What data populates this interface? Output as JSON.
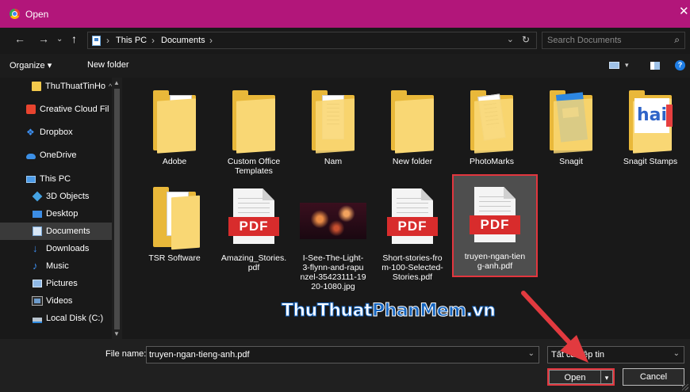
{
  "window": {
    "title": "Open"
  },
  "address": {
    "crumbs": [
      "This PC",
      "Documents"
    ],
    "search_placeholder": "Search Documents"
  },
  "toolbar": {
    "organize": "Organize ▾",
    "new_folder": "New folder"
  },
  "sidebar": {
    "items": [
      {
        "label": "ThuThuatTinHo",
        "icon": "folder-icon"
      },
      {
        "label": "Creative Cloud Fil",
        "icon": "creative-cloud-icon"
      },
      {
        "label": "Dropbox",
        "icon": "dropbox-icon"
      },
      {
        "label": "OneDrive",
        "icon": "onedrive-icon"
      },
      {
        "label": "This PC",
        "icon": "this-pc-icon"
      },
      {
        "label": "3D Objects",
        "icon": "3d-objects-icon"
      },
      {
        "label": "Desktop",
        "icon": "desktop-icon"
      },
      {
        "label": "Documents",
        "icon": "documents-icon",
        "selected": true
      },
      {
        "label": "Downloads",
        "icon": "downloads-icon"
      },
      {
        "label": "Music",
        "icon": "music-icon"
      },
      {
        "label": "Pictures",
        "icon": "pictures-icon"
      },
      {
        "label": "Videos",
        "icon": "videos-icon"
      },
      {
        "label": "Local Disk (C:)",
        "icon": "local-disk-icon"
      }
    ]
  },
  "files": [
    {
      "name": "Adobe",
      "type": "folder"
    },
    {
      "name": "Custom Office\nTemplates",
      "type": "folder"
    },
    {
      "name": "Nam",
      "type": "folder"
    },
    {
      "name": "New folder",
      "type": "folder"
    },
    {
      "name": "PhotoMarks",
      "type": "folder"
    },
    {
      "name": "Snagit",
      "type": "folder"
    },
    {
      "name": "Snagit Stamps",
      "type": "folder"
    },
    {
      "name": "TSR Software",
      "type": "folder"
    },
    {
      "name": "Amazing_Stories.\npdf",
      "type": "pdf",
      "badge": "PDF"
    },
    {
      "name": "I-See-The-Light-\n3-flynn-and-rapu\nnzel-35423111-19\n20-1080.jpg",
      "type": "image"
    },
    {
      "name": "Short-stories-fro\nm-100-Selected-\nStories.pdf",
      "type": "pdf",
      "badge": "PDF"
    },
    {
      "name": "truyen-ngan-tien\ng-anh.pdf",
      "type": "pdf",
      "badge": "PDF",
      "selected": true
    }
  ],
  "watermark": {
    "part1": "ThuThuat",
    "part2": "PhanMem",
    "part3": ".vn"
  },
  "footer": {
    "file_name_label": "File name:",
    "file_name_value": "truyen-ngan-tieng-anh.pdf",
    "filter": "Tất cả Tệp tin",
    "open": "Open",
    "cancel": "Cancel"
  },
  "colors": {
    "titlebar": "#b2167a",
    "highlight": "#e2363e",
    "watermark_blue": "#1565c0"
  }
}
